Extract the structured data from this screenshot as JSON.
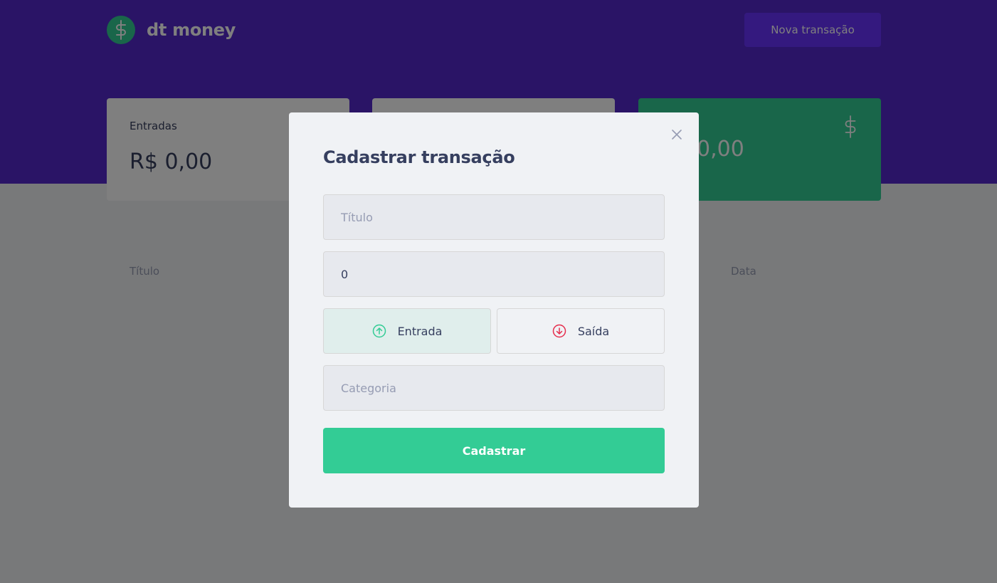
{
  "app": {
    "logo_text": "dt money",
    "new_transaction_label": "Nova transação"
  },
  "summary": [
    {
      "label": "Entradas",
      "value": "R$ 0,00"
    },
    {
      "label": "",
      "value": ""
    },
    {
      "label": "",
      "value": "0,00"
    }
  ],
  "table": {
    "headers": [
      "Título",
      "Data"
    ]
  },
  "modal": {
    "title": "Cadastrar transação",
    "title_placeholder": "Título",
    "amount_value": "0",
    "income_label": "Entrada",
    "outcome_label": "Saída",
    "category_placeholder": "Categoria",
    "submit_label": "Cadastrar"
  },
  "icons": {
    "logo": "dollar-sign-icon",
    "total": "dollar-sign-icon",
    "close": "close-icon",
    "income": "arrow-up-circle-icon",
    "outcome": "arrow-down-circle-icon"
  },
  "colors": {
    "brand": "#5429cc",
    "button": "#6933ff",
    "green": "#33cc95",
    "red": "#e52e4d",
    "text": "#363f5f",
    "muted": "#969cb3"
  }
}
